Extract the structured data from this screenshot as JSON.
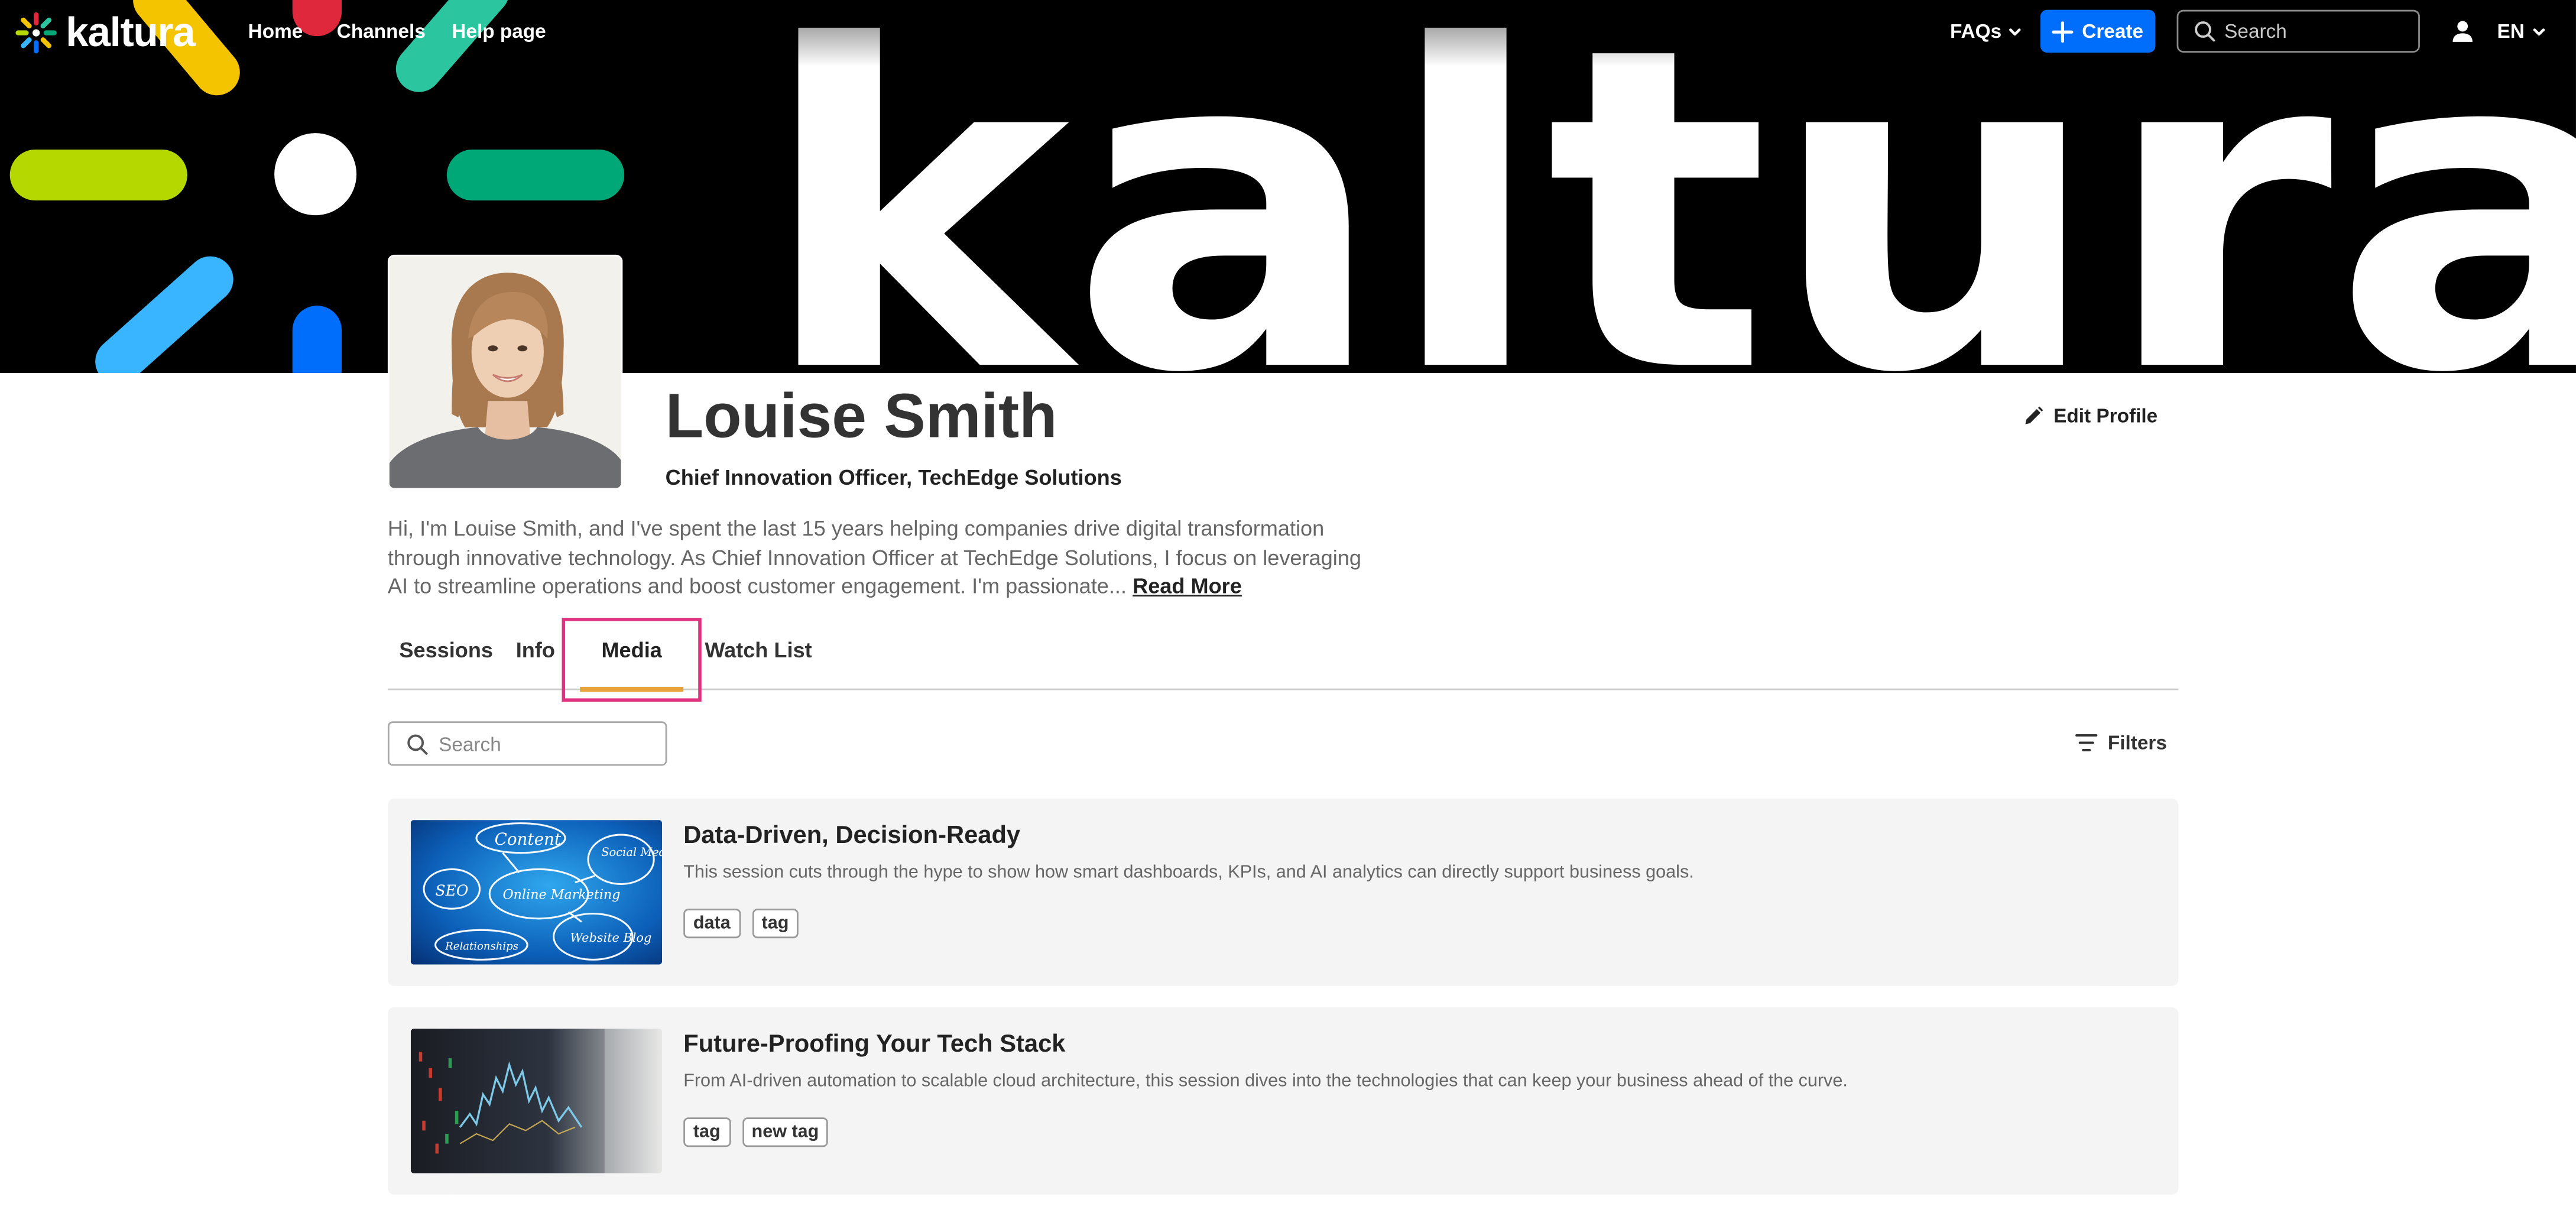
{
  "app": {
    "brand": "kaltura",
    "banner_wordmark": "kaltura"
  },
  "nav": {
    "links": [
      "Home",
      "Channels",
      "Help page"
    ],
    "faqs_label": "FAQs",
    "create_label": "Create",
    "search_placeholder": "Search",
    "language": "EN"
  },
  "profile": {
    "name": "Louise Smith",
    "title": "Chief Innovation Officer, TechEdge Solutions",
    "bio": "Hi, I'm Louise Smith, and I've spent the last 15 years helping companies drive digital transformation through innovative technology. As Chief Innovation Officer at TechEdge Solutions, I focus on leveraging AI to streamline operations and boost customer engagement. I'm passionate...",
    "read_more_label": "Read More",
    "edit_label": "Edit Profile"
  },
  "tabs": [
    {
      "label": "Sessions",
      "active": false
    },
    {
      "label": "Info",
      "active": false
    },
    {
      "label": "Media",
      "active": true
    },
    {
      "label": "Watch List",
      "active": false
    }
  ],
  "media": {
    "search_placeholder": "Search",
    "filters_label": "Filters",
    "items": [
      {
        "title": "Data-Driven, Decision-Ready",
        "description": "This session cuts through the hype to show how smart dashboards, KPIs, and AI analytics can directly support business goals.",
        "tags": [
          "data",
          "tag"
        ],
        "thumb_words": [
          "Content",
          "Social Media",
          "SEO",
          "Online Marketing",
          "Website Blog",
          "Relationships"
        ]
      },
      {
        "title": "Future-Proofing Your Tech Stack",
        "description": "From AI-driven automation to scalable cloud architecture, this session dives into the technologies that can keep your business ahead of the curve.",
        "tags": [
          "tag",
          "new tag"
        ]
      }
    ]
  },
  "colors": {
    "accent": "#006efa",
    "tab_underline": "#e8a33d",
    "highlight_box": "#e0327e",
    "card_background": "#f4f4f4"
  }
}
